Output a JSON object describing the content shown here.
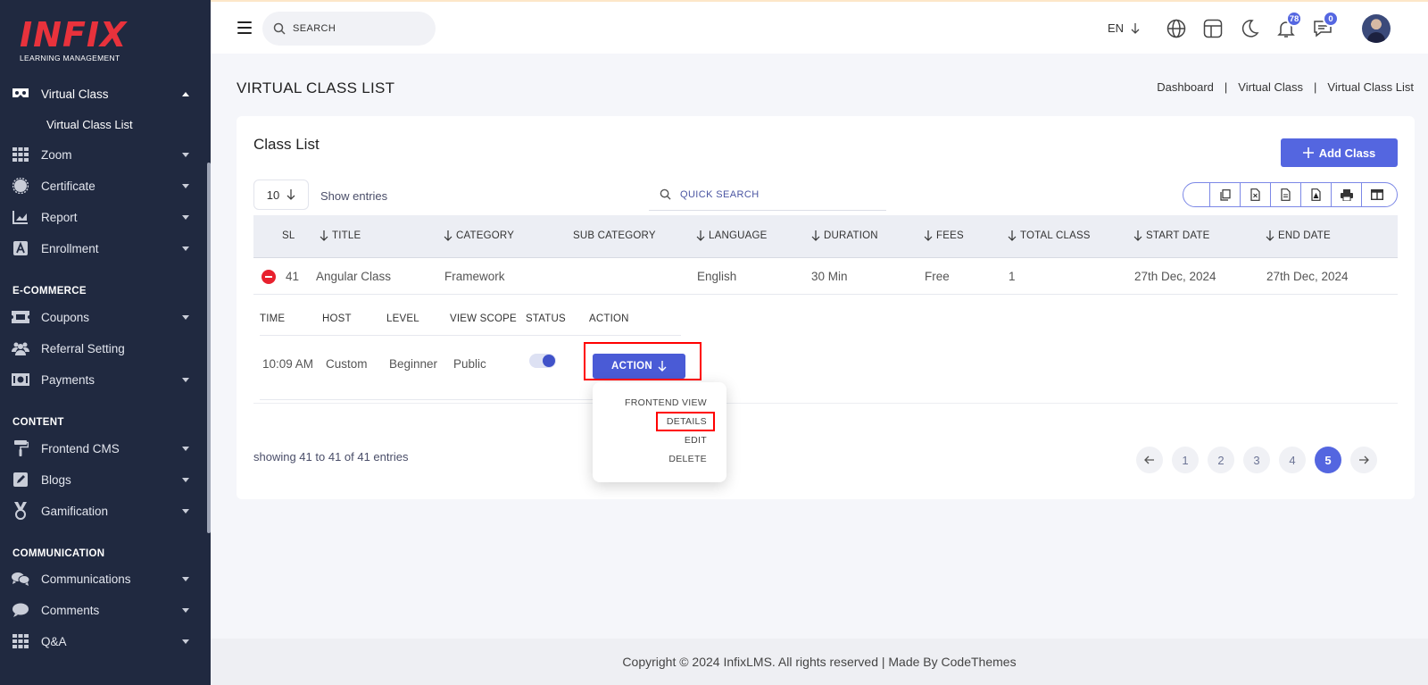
{
  "brand": {
    "logo_text": "INFIX",
    "logo_sub": "LEARNING MANAGEMENT",
    "logo_color": "#e8323c"
  },
  "sidebar": {
    "items": [
      {
        "label": "Virtual Class",
        "icon": "vr-headset-icon",
        "expanded": true
      },
      {
        "label": "Zoom",
        "icon": "grid-icon"
      },
      {
        "label": "Certificate",
        "icon": "certificate-badge-icon"
      },
      {
        "label": "Report",
        "icon": "chart-icon"
      },
      {
        "label": "Enrollment",
        "icon": "enrollment-icon"
      },
      {
        "label": "Coupons",
        "icon": "ticket-icon"
      },
      {
        "label": "Referral Setting",
        "icon": "users-icon"
      },
      {
        "label": "Payments",
        "icon": "money-icon"
      },
      {
        "label": "Frontend CMS",
        "icon": "paint-roller-icon"
      },
      {
        "label": "Blogs",
        "icon": "pencil-square-icon"
      },
      {
        "label": "Gamification",
        "icon": "medal-icon"
      },
      {
        "label": "Communications",
        "icon": "chat-bubbles-icon"
      },
      {
        "label": "Comments",
        "icon": "comment-icon"
      },
      {
        "label": "Q&A",
        "icon": "grid-icon"
      }
    ],
    "sub_item": "Virtual Class List",
    "sections": {
      "ecommerce": "E-COMMERCE",
      "content": "CONTENT",
      "communication": "COMMUNICATION"
    }
  },
  "topbar": {
    "search_placeholder": "SEARCH",
    "language": "EN",
    "notifications_count": "78",
    "messages_count": "0"
  },
  "page": {
    "title": "VIRTUAL CLASS LIST",
    "breadcrumb": [
      "Dashboard",
      "Virtual Class",
      "Virtual Class List"
    ]
  },
  "card": {
    "title": "Class List",
    "add_button": "Add Class",
    "entries_value": "10",
    "entries_label": "Show entries",
    "quick_search_placeholder": "QUICK SEARCH",
    "export_icons": [
      "copy-icon",
      "excel-icon",
      "csv-icon",
      "pdf-icon",
      "print-icon",
      "columns-icon"
    ]
  },
  "table": {
    "headers": [
      "SL",
      "TITLE",
      "CATEGORY",
      "SUB CATEGORY",
      "LANGUAGE",
      "DURATION",
      "FEES",
      "TOTAL CLASS",
      "START DATE",
      "END DATE"
    ],
    "row": {
      "sl": "41",
      "title": "Angular Class",
      "category": "Framework",
      "sub_category": "",
      "language": "English",
      "duration": "30 Min",
      "fees": "Free",
      "total_class": "1",
      "start_date": "27th Dec, 2024",
      "end_date": "27th Dec, 2024"
    },
    "child_headers": [
      "TIME",
      "HOST",
      "LEVEL",
      "VIEW SCOPE",
      "STATUS",
      "ACTION"
    ],
    "child_row": {
      "time": "10:09 AM",
      "host": "Custom",
      "level": "Beginner",
      "view_scope": "Public",
      "status_on": true,
      "action_label": "ACTION"
    },
    "action_menu": [
      "FRONTEND VIEW",
      "DETAILS",
      "EDIT",
      "DELETE"
    ]
  },
  "pagination": {
    "showing": "showing 41 to 41 of 41 entries",
    "pages": [
      "1",
      "2",
      "3",
      "4",
      "5"
    ],
    "active": "5"
  },
  "footer": {
    "text": "Copyright © 2024 InfixLMS. All rights reserved | Made By CodeThemes"
  },
  "colors": {
    "primary": "#5466e0",
    "sidebar_bg": "#202940",
    "danger": "#e8212e",
    "highlight": "#ff0000"
  }
}
